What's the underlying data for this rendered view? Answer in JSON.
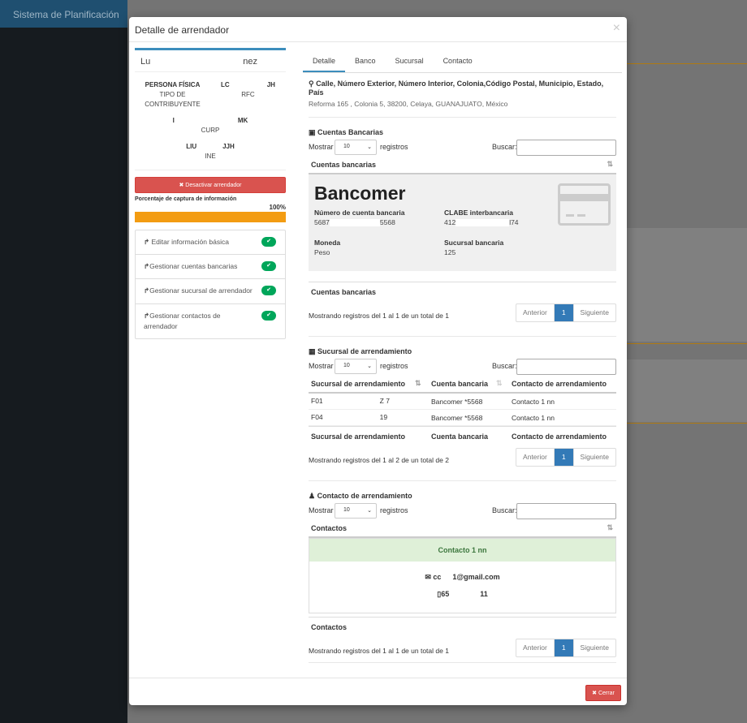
{
  "app": {
    "brand": "Sistema de Planificación"
  },
  "modal": {
    "title": "Detalle de arrendador",
    "close": "×",
    "close_button": "✖ Cerrar"
  },
  "profile": {
    "name_start": "Lu",
    "name_end": "nez",
    "person_type": "PERSONA FÍSICA",
    "person_type_label": "TIPO DE CONTRIBUYENTE",
    "rfc_start": "LC",
    "rfc_end": "JH",
    "rfc_label": "RFC",
    "curp_start": "I",
    "curp_end": "MK",
    "curp_label": "CURP",
    "ine_start": "LIU",
    "ine_end": "JJH",
    "ine_label": "INE"
  },
  "deactivate_button": "✖ Desactivar arrendador",
  "progress": {
    "label": "Porcentaje de captura de información",
    "percent_text": "100%",
    "value": 100
  },
  "actions": [
    {
      "label": "Editar información básica"
    },
    {
      "label": "Gestionar cuentas bancarias"
    },
    {
      "label": "Gestionar sucursal de arrendador"
    },
    {
      "label": "Gestionar contactos de arrendador"
    }
  ],
  "tabs": [
    "Detalle",
    "Banco",
    "Sucursal",
    "Contacto"
  ],
  "address": {
    "title": "Calle, Número Exterior, Número Interior, Colonia,Código Postal, Municipio, Estado, País",
    "value": "Reforma 165 , Colonia 5, 38200, Celaya, GUANAJUATO, México"
  },
  "labels": {
    "show": "Mostrar",
    "records": "registros",
    "search": "Buscar:",
    "page_size": "10"
  },
  "bank_section": {
    "title": "Cuentas Bancarias",
    "column": "Cuentas bancarias",
    "bank_name": "Bancomer",
    "account_label": "Número de cuenta bancaria",
    "account_start": "5687",
    "account_end": "5568",
    "clabe_label": "CLABE interbancaria",
    "clabe_start": "412",
    "clabe_end": "l74",
    "currency_label": "Moneda",
    "currency_value": "Peso",
    "branch_label": "Sucursal bancaria",
    "branch_value": "125",
    "footer": "Cuentas bancarias",
    "info": "Mostrando registros del 1 al 1 de un total de 1"
  },
  "branch_section": {
    "title": "Sucursal de arrendamiento",
    "columns": [
      "Sucursal de arrendamiento",
      "Cuenta bancaria",
      "Contacto de arrendamiento"
    ],
    "rows": [
      {
        "branch_start": "F01",
        "branch_end": "Z 7",
        "account": "Bancomer *5568",
        "contact": "Contacto 1 nn"
      },
      {
        "branch_start": "F04",
        "branch_end": "19",
        "account": "Bancomer *5568",
        "contact": "Contacto 1 nn"
      }
    ],
    "info": "Mostrando registros del 1 al 2 de un total de 2"
  },
  "contact_section": {
    "title": "Contacto de arrendamiento",
    "column": "Contactos",
    "contact_name": "Contacto 1 nn",
    "email_start": "cc",
    "email_end": "1@gmail.com",
    "phone_start": "65",
    "phone_end": "11",
    "footer": "Contactos",
    "info": "Mostrando registros del 1 al 1 de un total de 1"
  },
  "pager": {
    "prev": "Anterior",
    "page": "1",
    "next": "Siguiente"
  },
  "colors": {
    "primary": "#3c8dbc",
    "danger": "#d9534f",
    "warning": "#f39c12",
    "success": "#00a65a"
  }
}
